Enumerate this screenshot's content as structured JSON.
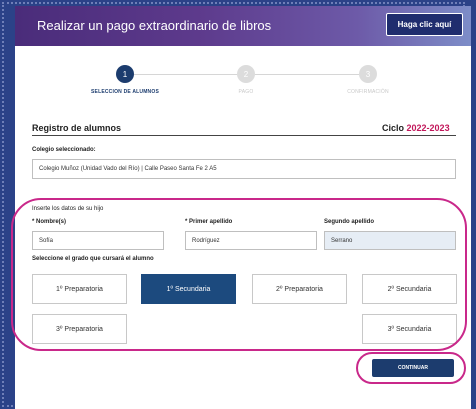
{
  "header": {
    "title": "Realizar un pago extraordinario de libros",
    "button_label": "Haga clic aquí"
  },
  "stepper": {
    "steps": [
      {
        "number": "1",
        "label": "SELECCION DE ALUMNOS",
        "active": true
      },
      {
        "number": "2",
        "label": "PAGO",
        "active": false
      },
      {
        "number": "3",
        "label": "CONFIRMACIÓN",
        "active": false
      }
    ]
  },
  "registro": {
    "title": "Registro de alumnos",
    "cycle_label": "Ciclo",
    "cycle_year": "2022-2023"
  },
  "colegio": {
    "label": "Colegio seleccionado:",
    "value": "Colegio Muñoz (Unidad Vado del Río) | Calle Paseo Santa Fe 2 A5"
  },
  "hijo": {
    "section_label": "Inserte los datos de su hijo",
    "nombre_label": "* Nombre(s)",
    "nombre_value": "Sofía",
    "primer_apellido_label": "* Primer apellido",
    "primer_apellido_value": "Rodríguez",
    "segundo_apellido_label": "Segundo apellido",
    "segundo_apellido_value": "Serrano"
  },
  "grados": {
    "label": "Seleccione el grado que cursará el alumno",
    "options": [
      {
        "label": "1º Preparatoria",
        "selected": false
      },
      {
        "label": "1º Secundaria",
        "selected": true
      },
      {
        "label": "2º Preparatoria",
        "selected": false
      },
      {
        "label": "2º Secundaria",
        "selected": false
      },
      {
        "label": "3º Preparatoria",
        "selected": false
      },
      {
        "label": "3º Secundaria",
        "selected": false
      }
    ]
  },
  "actions": {
    "continue_label": "CONTINUAR"
  },
  "colors": {
    "accent": "#1c3c6e",
    "highlight": "#c9288a",
    "cycle_year": "#c2185b"
  }
}
